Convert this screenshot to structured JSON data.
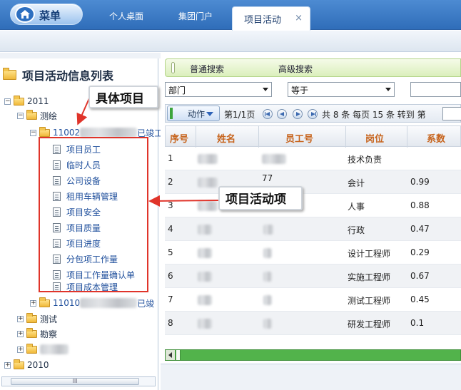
{
  "topbar": {
    "menu_label": "菜单",
    "tabs": [
      "个人桌面",
      "集团门户"
    ],
    "active_tab": "项目活动",
    "close_glyph": "×"
  },
  "left": {
    "title": "项目活动信息列表",
    "tree": {
      "y2011": "2011",
      "cehui": "测绘",
      "project1_prefix": "11002",
      "project1_suffix": "已竣工",
      "items": [
        "项目员工",
        "临时人员",
        "公司设备",
        "租用车辆管理",
        "项目安全",
        "项目质量",
        "项目进度",
        "分包项工作量",
        "项目工作量确认单",
        "项目成本管理"
      ],
      "project2_prefix": "11010",
      "project2_suffix": "已竣",
      "ceshi": "测试",
      "kancha": "勘察",
      "y2010": "2010"
    },
    "scroll_grip": "III"
  },
  "annotations": {
    "specific_project": "具体项目",
    "activity_items": "项目活动项"
  },
  "search": {
    "normal": "普通搜索",
    "advanced": "高级搜索",
    "field_select": "部门",
    "operator_select": "等于"
  },
  "toolbar": {
    "action": "动作",
    "page_info": "第1/1页",
    "total": "共 8 条 每页 15 条 转到 第"
  },
  "grid": {
    "headers": [
      "序号",
      "姓名",
      "员工号",
      "岗位",
      "系数"
    ],
    "rows": [
      {
        "no": "1",
        "empno": "",
        "post": "技术负责",
        "coef": ""
      },
      {
        "no": "2",
        "empno": "77",
        "post": "会计",
        "coef": "0.99"
      },
      {
        "no": "3",
        "empno": "",
        "post": "人事",
        "coef": "0.88"
      },
      {
        "no": "4",
        "empno": "",
        "post": "行政",
        "coef": "0.47"
      },
      {
        "no": "5",
        "empno": "",
        "post": "设计工程师",
        "coef": "0.29"
      },
      {
        "no": "6",
        "empno": "",
        "post": "实施工程师",
        "coef": "0.67"
      },
      {
        "no": "7",
        "empno": "",
        "post": "测试工程师",
        "coef": "0.45"
      },
      {
        "no": "8",
        "empno": "",
        "post": "研发工程师",
        "coef": "0.1"
      }
    ]
  },
  "colors": {
    "accent_red": "#e0342a",
    "header_orange": "#c7641d",
    "search_green": "#dbefbc"
  }
}
